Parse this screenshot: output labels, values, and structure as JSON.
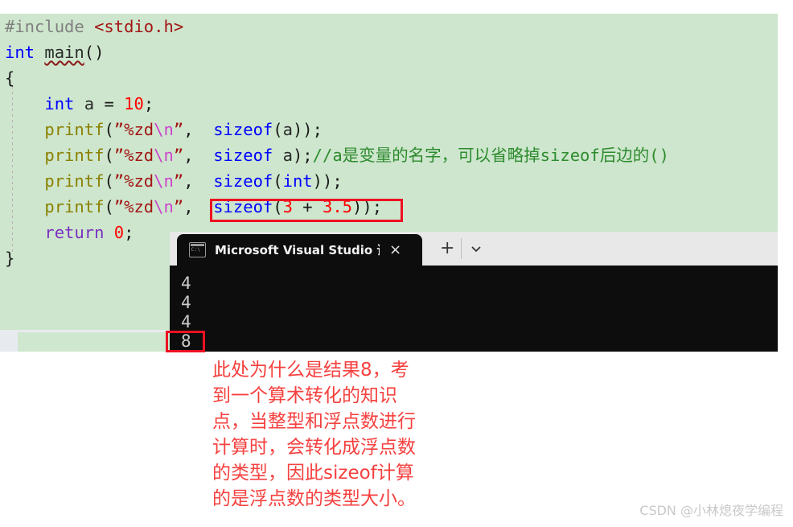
{
  "editor": {
    "background_color": "#cde6cd",
    "lines": [
      {
        "id": "line-include",
        "tokens": [
          {
            "cls": "c-pre",
            "t": "#include "
          },
          {
            "cls": "c-header",
            "t": "<stdio.h>"
          }
        ]
      },
      {
        "id": "line-main",
        "tokens": [
          {
            "cls": "c-kw",
            "t": "int "
          },
          {
            "cls": "c-ident squiggle",
            "t": "main"
          },
          {
            "cls": "c-punct",
            "t": "()"
          }
        ]
      },
      {
        "id": "line-open-brace",
        "tokens": [
          {
            "cls": "c-punct",
            "t": "{"
          }
        ]
      },
      {
        "id": "line-decl-a",
        "tokens": [
          {
            "cls": "c-plain",
            "t": "    "
          },
          {
            "cls": "c-kw",
            "t": "int "
          },
          {
            "cls": "c-ident",
            "t": "a "
          },
          {
            "cls": "c-punct",
            "t": "= "
          },
          {
            "cls": "c-num",
            "t": "10"
          },
          {
            "cls": "c-punct",
            "t": ";"
          }
        ]
      },
      {
        "id": "line-printf-1",
        "tokens": [
          {
            "cls": "c-plain",
            "t": "    "
          },
          {
            "cls": "c-fn",
            "t": "printf"
          },
          {
            "cls": "c-punct",
            "t": "("
          },
          {
            "cls": "c-str",
            "t": "”%zd"
          },
          {
            "cls": "c-esc",
            "t": "\\n"
          },
          {
            "cls": "c-str",
            "t": "”"
          },
          {
            "cls": "c-punct",
            "t": ",  "
          },
          {
            "cls": "c-kw",
            "t": "sizeof"
          },
          {
            "cls": "c-punct",
            "t": "("
          },
          {
            "cls": "c-ident",
            "t": "a"
          },
          {
            "cls": "c-punct",
            "t": "));"
          }
        ]
      },
      {
        "id": "line-printf-2",
        "tokens": [
          {
            "cls": "c-plain",
            "t": "    "
          },
          {
            "cls": "c-fn",
            "t": "printf"
          },
          {
            "cls": "c-punct",
            "t": "("
          },
          {
            "cls": "c-str",
            "t": "”%zd"
          },
          {
            "cls": "c-esc",
            "t": "\\n"
          },
          {
            "cls": "c-str",
            "t": "”"
          },
          {
            "cls": "c-punct",
            "t": ",  "
          },
          {
            "cls": "c-kw",
            "t": "sizeof"
          },
          {
            "cls": "c-plain",
            "t": " "
          },
          {
            "cls": "c-ident",
            "t": "a"
          },
          {
            "cls": "c-punct",
            "t": ");"
          },
          {
            "cls": "c-comment",
            "t": "//a是变量的名字，可以省略掉sizeof后边的()"
          }
        ]
      },
      {
        "id": "line-printf-3",
        "tokens": [
          {
            "cls": "c-plain",
            "t": "    "
          },
          {
            "cls": "c-fn",
            "t": "printf"
          },
          {
            "cls": "c-punct",
            "t": "("
          },
          {
            "cls": "c-str",
            "t": "”%zd"
          },
          {
            "cls": "c-esc",
            "t": "\\n"
          },
          {
            "cls": "c-str",
            "t": "”"
          },
          {
            "cls": "c-punct",
            "t": ",  "
          },
          {
            "cls": "c-kw",
            "t": "sizeof"
          },
          {
            "cls": "c-punct",
            "t": "("
          },
          {
            "cls": "c-kw",
            "t": "int"
          },
          {
            "cls": "c-punct",
            "t": "));"
          }
        ]
      },
      {
        "id": "line-printf-4",
        "tokens": [
          {
            "cls": "c-plain",
            "t": "    "
          },
          {
            "cls": "c-fn",
            "t": "printf"
          },
          {
            "cls": "c-punct",
            "t": "("
          },
          {
            "cls": "c-str",
            "t": "”%zd"
          },
          {
            "cls": "c-esc",
            "t": "\\n"
          },
          {
            "cls": "c-str",
            "t": "”"
          },
          {
            "cls": "c-punct",
            "t": ",  "
          },
          {
            "cls": "c-kw",
            "t": "sizeof"
          },
          {
            "cls": "c-punct",
            "t": "("
          },
          {
            "cls": "c-num",
            "t": "3"
          },
          {
            "cls": "c-punct",
            "t": " + "
          },
          {
            "cls": "c-num",
            "t": "3.5"
          },
          {
            "cls": "c-punct",
            "t": "));"
          }
        ]
      },
      {
        "id": "line-return",
        "tokens": [
          {
            "cls": "c-plain",
            "t": "    "
          },
          {
            "cls": "c-ret",
            "t": "return "
          },
          {
            "cls": "c-num",
            "t": "0"
          },
          {
            "cls": "c-punct",
            "t": ";"
          }
        ]
      },
      {
        "id": "line-close-brace",
        "tokens": [
          {
            "cls": "c-punct",
            "t": "}"
          }
        ]
      }
    ],
    "highlight_box_color": "#ee1122"
  },
  "console": {
    "tab_title": "Microsoft Visual Studio 调试控",
    "tab_icon": "console-icon",
    "close_label": "×",
    "new_tab_label": "+",
    "dropdown_label": "chevron-down-icon",
    "background_color": "#0d0d0d",
    "output": [
      "4",
      "4",
      "4",
      "8"
    ]
  },
  "annotation": {
    "color": "#f5413f",
    "lines": [
      "此处为什么是结果8，考",
      "到一个算术转化的知识",
      "点，当整型和浮点数进行",
      "计算时，会转化成浮点数",
      "的类型，因此sizeof计算",
      "的是浮点数的类型大小。"
    ]
  },
  "watermark": {
    "text": "CSDN @小林熄夜学编程"
  }
}
